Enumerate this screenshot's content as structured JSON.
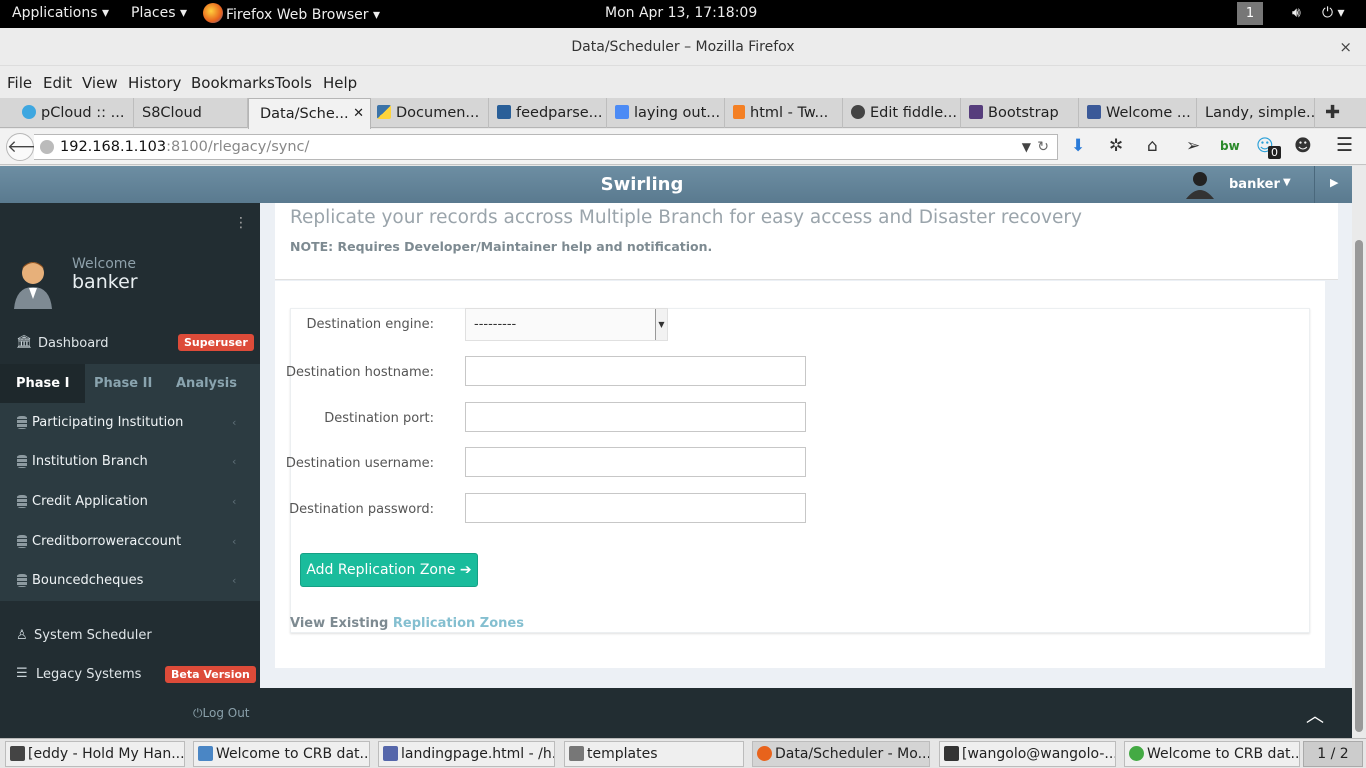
{
  "gnome_bar": {
    "applications": "Applications ▾",
    "places": "Places ▾",
    "active_app": "Firefox Web Browser ▾",
    "clock": "Mon Apr 13, 17:18:09",
    "workspace": "1"
  },
  "window": {
    "title": "Data/Scheduler – Mozilla Firefox",
    "close": "×"
  },
  "menu": [
    "File",
    "Edit",
    "View",
    "History",
    "Bookmarks",
    "Tools",
    "Help"
  ],
  "tabs": [
    {
      "label": "pCloud :: ...",
      "color": "#3ea7e0"
    },
    {
      "label": "S8Cloud",
      "color": "#bbbbbb"
    },
    {
      "label": "Data/Sche...",
      "color": "#888888"
    },
    {
      "label": "Documen...",
      "color": "#3b73a8"
    },
    {
      "label": "feedparse...",
      "color": "#2a5f98"
    },
    {
      "label": "laying out...",
      "color": "#4c8bf5"
    },
    {
      "label": "html - Tw...",
      "color": "#f48024"
    },
    {
      "label": "Edit fiddle...",
      "color": "#444444"
    },
    {
      "label": "Bootstrap",
      "color": "#563d7c"
    },
    {
      "label": "Welcome ...",
      "color": "#3b5998"
    },
    {
      "label": "Landy, simple..."
    }
  ],
  "nav": {
    "url_host": "192.168.1.103",
    "url_rest": ":8100/rlegacy/sync/",
    "badge_count": "0"
  },
  "app": {
    "title": "Swirling",
    "user": "banker"
  },
  "sidebar": {
    "welcome": "Welcome",
    "user": "banker",
    "dashboard": "Dashboard",
    "dashboard_badge": "Superuser",
    "tabs": [
      "Phase I",
      "Phase II",
      "Analysis"
    ],
    "items": [
      "Participating Institution",
      "Institution Branch",
      "Credit Application",
      "Creditborroweraccount",
      "Bouncedcheques"
    ],
    "system_scheduler": "System Scheduler",
    "legacy_systems": "Legacy Systems",
    "legacy_badge": "Beta Version",
    "logout": "Log Out"
  },
  "content": {
    "heading": "Replicate your records accross Multiple Branch for easy access and Disaster recovery",
    "note": "NOTE: Requires Developer/Maintainer help and notification.",
    "form": {
      "engine_label": "Destination engine:",
      "engine_value": "---------",
      "hostname_label": "Destination hostname:",
      "port_label": "Destination port:",
      "username_label": "Destination username:",
      "password_label": "Destination password:",
      "submit": "Add Replication Zone ➔"
    },
    "view_prefix": "View Existing",
    "view_link": "Replication Zones"
  },
  "taskbar": [
    {
      "label": "[eddy - Hold My Han...",
      "color": "#444444"
    },
    {
      "label": "Welcome to CRB dat...",
      "color": "#4a86c5"
    },
    {
      "label": "landingpage.html - /h...",
      "color": "#5566aa"
    },
    {
      "label": "templates",
      "color": "#777777"
    },
    {
      "label": "Data/Scheduler - Mo...",
      "color": "#e8631c"
    },
    {
      "label": "[wangolo@wangolo-...",
      "color": "#333333"
    },
    {
      "label": "Welcome to CRB dat...",
      "color": "#44aa44"
    }
  ],
  "pager": "1 / 2"
}
